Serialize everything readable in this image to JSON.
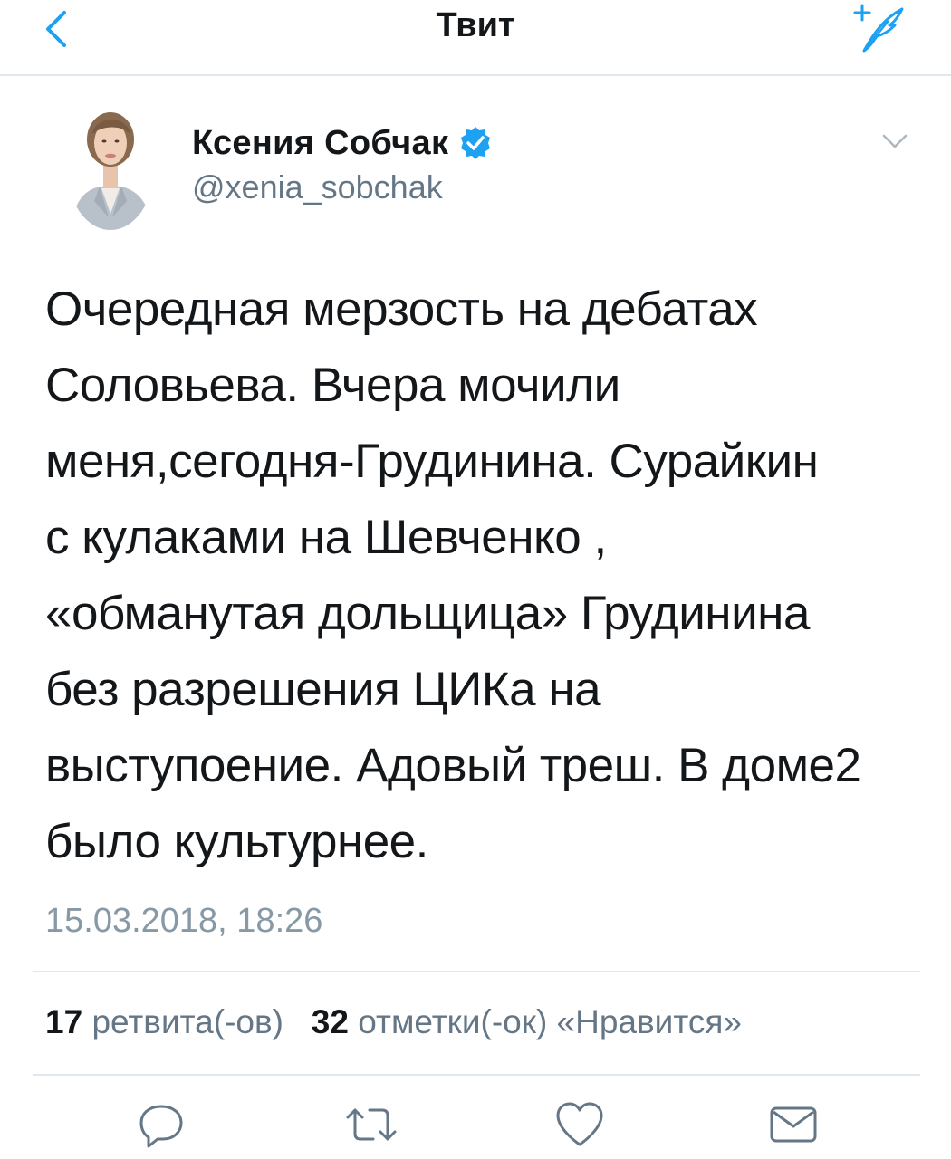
{
  "nav": {
    "title": "Твит"
  },
  "author": {
    "name": "Ксения Собчак",
    "handle": "@xenia_sobchak",
    "verified": true
  },
  "tweet": {
    "text": "Очередная мерзость на дебатах\nСоловьева. Вчера мочили\nменя,сегодня-Грудинина. Сурайкин\nс кулаками на Шевченко ,\n«обманутая дольщица» Грудинина\nбез разрешения ЦИКа на\nвыступоение. Адовый треш. В доме2\nбыло культурнее.",
    "timestamp": "15.03.2018, 18:26"
  },
  "stats": {
    "retweets_count": "17",
    "retweets_label": "ретвита(-ов)",
    "likes_count": "32",
    "likes_label": "отметки(-ок) «Нравится»"
  },
  "icons": {
    "back": "chevron-left-icon",
    "compose": "compose-tweet-icon",
    "verified": "verified-badge-icon",
    "caret": "chevron-down-icon",
    "reply": "reply-icon",
    "retweet": "retweet-icon",
    "like": "heart-icon",
    "dm": "envelope-icon"
  },
  "colors": {
    "accent": "#1da1f2",
    "text": "#14171a",
    "secondary": "#657786",
    "timestamp": "#8899a6",
    "divider": "#e1e8ed"
  }
}
